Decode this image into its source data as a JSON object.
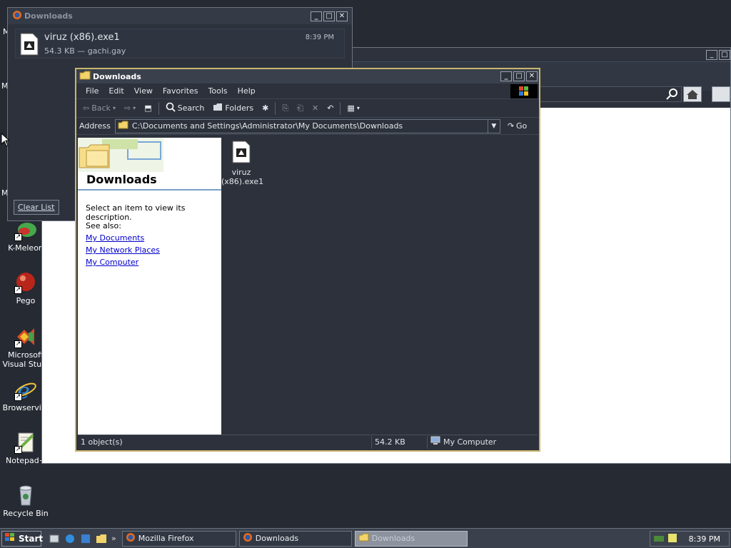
{
  "desktop": {
    "icons": [
      {
        "label": "K-Meleon"
      },
      {
        "label": "Pego"
      },
      {
        "label": "Microsoft Visual Stu..."
      },
      {
        "label": "Browservi..."
      },
      {
        "label": "Notepad+"
      },
      {
        "label": "Recycle Bin"
      }
    ],
    "partial_letters": [
      "M",
      "M",
      "M"
    ]
  },
  "firefox_downloads": {
    "title": "Downloads",
    "item": {
      "filename": "viruz (x86).exe1",
      "meta": "54.3 KB — gachi.gay",
      "time": "8:39 PM"
    },
    "clear_list_label": "Clear List"
  },
  "explorer": {
    "title": "Downloads",
    "menu": [
      "File",
      "Edit",
      "View",
      "Favorites",
      "Tools",
      "Help"
    ],
    "toolbar": {
      "back": "Back",
      "search": "Search",
      "folders": "Folders"
    },
    "address": {
      "label": "Address",
      "path": "C:\\Documents and Settings\\Administrator\\My Documents\\Downloads",
      "go": "Go"
    },
    "taskpane": {
      "title": "Downloads",
      "description": "Select an item to view its description.",
      "see_also": "See also:",
      "links": [
        "My Documents",
        "My Network Places",
        "My Computer"
      ]
    },
    "file": {
      "name_line1": "viruz",
      "name_line2": "(x86).exe1"
    },
    "status": {
      "objects": "1 object(s)",
      "size": "54.2 KB",
      "location": "My Computer"
    }
  },
  "taskbar": {
    "start": "Start",
    "tasks": [
      "Mozilla Firefox",
      "Downloads",
      "Downloads"
    ],
    "clock": "8:39 PM"
  },
  "colors": {
    "desktop": "#252a33",
    "window_border_active": "#c8b66d",
    "link": "#0000cc"
  }
}
